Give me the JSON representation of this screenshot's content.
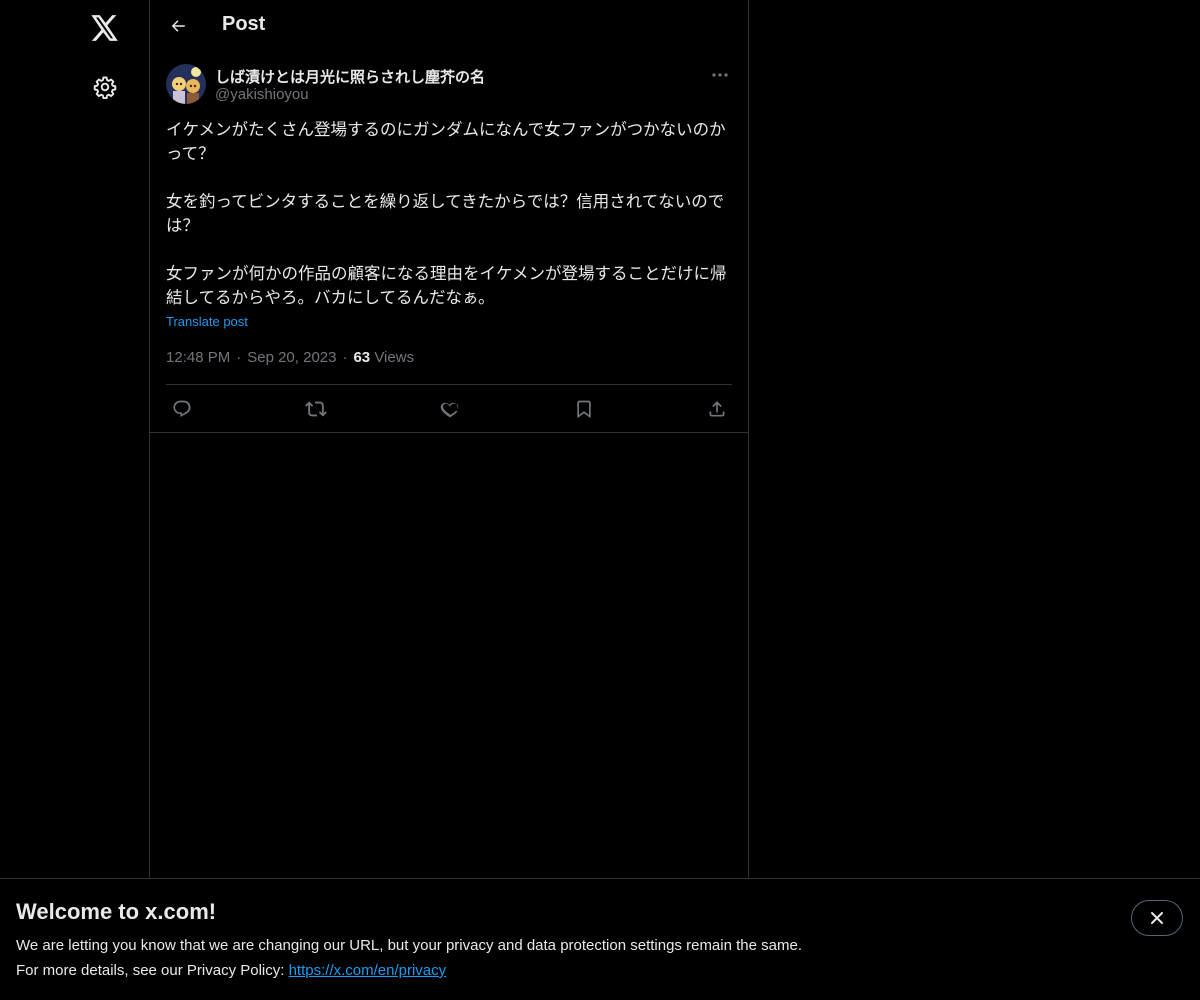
{
  "nav": {
    "logo_icon": "x-logo-icon",
    "settings_icon": "gear-icon"
  },
  "header": {
    "back_icon": "arrow-left-icon",
    "title": "Post"
  },
  "post": {
    "author_name": "しば漬けとは月光に照らされし塵芥の名",
    "author_handle": "@yakishioyou",
    "text": "イケメンがたくさん登場するのにガンダムになんで女ファンがつかないのかって？\n\n女を釣ってビンタすることを繰り返してきたからでは？信用されてないのでは？\n\n女ファンが何かの作品の顧客になる理由をイケメンが登場することだけに帰結してるからやろ。バカにしてるんだなぁ。",
    "translate_label": "Translate post",
    "time": "12:48 PM",
    "date": "Sep 20, 2023",
    "views_count": "63",
    "views_label": "Views",
    "separator": "·",
    "actions": {
      "reply_icon": "reply-icon",
      "repost_icon": "repost-icon",
      "like_icon": "heart-icon",
      "bookmark_icon": "bookmark-icon",
      "share_icon": "share-icon"
    }
  },
  "banner": {
    "title": "Welcome to x.com!",
    "line1": "We are letting you know that we are changing our URL, but your privacy and data protection settings remain the same.",
    "line2_prefix": "For more details, see our Privacy Policy: ",
    "link_text": "https://x.com/en/privacy",
    "close_icon": "close-icon"
  },
  "colors": {
    "background": "#000000",
    "text": "#e7e9ea",
    "secondary_text": "#71767b",
    "accent": "#1d9bf0",
    "border": "#2f3336"
  }
}
